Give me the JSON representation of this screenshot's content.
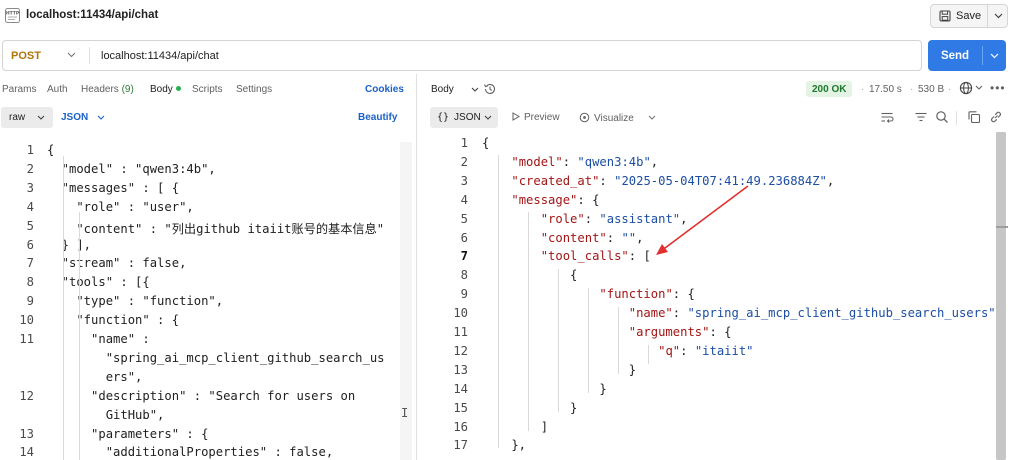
{
  "header": {
    "tab_title": "localhost:11434/api/chat",
    "save_label": "Save"
  },
  "request": {
    "method": "POST",
    "url": "localhost:11434/api/chat",
    "send_label": "Send"
  },
  "left_tabs": {
    "params": "Params",
    "auth": "Auth",
    "headers": "Headers",
    "headers_count": "(9)",
    "body": "Body",
    "scripts": "Scripts",
    "settings": "Settings",
    "cookies": "Cookies"
  },
  "body_options": {
    "mode": "raw",
    "format": "JSON",
    "beautify": "Beautify"
  },
  "response_header": {
    "view": "Body",
    "status": "200 OK",
    "time": "17.50 s",
    "size": "530 B",
    "separator": "·"
  },
  "response_options": {
    "format": "JSON",
    "preview": "Preview",
    "visualize": "Visualize"
  },
  "request_body_lines": [
    {
      "n": "1",
      "t": "{"
    },
    {
      "n": "2",
      "t": "  \"model\" : \"qwen3:4b\","
    },
    {
      "n": "3",
      "t": "  \"messages\" : [ {"
    },
    {
      "n": "4",
      "t": "    \"role\" : \"user\","
    },
    {
      "n": "5",
      "t": "    \"content\" : \"列出github itaiit账号的基本信息\""
    },
    {
      "n": "6",
      "t": "  } ],"
    },
    {
      "n": "7",
      "t": "  \"stream\" : false,"
    },
    {
      "n": "8",
      "t": "  \"tools\" : [{"
    },
    {
      "n": "9",
      "t": "    \"type\" : \"function\","
    },
    {
      "n": "10",
      "t": "    \"function\" : {"
    },
    {
      "n": "11",
      "t": "      \"name\" :"
    },
    {
      "n": "",
      "t": "        \"spring_ai_mcp_client_github_search_us"
    },
    {
      "n": "",
      "t": "        ers\","
    },
    {
      "n": "12",
      "t": "      \"description\" : \"Search for users on"
    },
    {
      "n": "",
      "t": "        GitHub\","
    },
    {
      "n": "13",
      "t": "      \"parameters\" : {"
    },
    {
      "n": "14",
      "t": "        \"additionalProperties\" : false,"
    }
  ],
  "response_body_lines": [
    {
      "n": "1",
      "t": "{"
    },
    {
      "n": "2",
      "t": "    \"model\": \"qwen3:4b\","
    },
    {
      "n": "3",
      "t": "    \"created_at\": \"2025-05-04T07:41:49.236884Z\","
    },
    {
      "n": "4",
      "t": "    \"message\": {"
    },
    {
      "n": "5",
      "t": "        \"role\": \"assistant\","
    },
    {
      "n": "6",
      "t": "        \"content\": \"\","
    },
    {
      "n": "7",
      "t": "        \"tool_calls\": ["
    },
    {
      "n": "8",
      "t": "            {"
    },
    {
      "n": "9",
      "t": "                \"function\": {"
    },
    {
      "n": "10",
      "t": "                    \"name\": \"spring_ai_mcp_client_github_search_users\","
    },
    {
      "n": "11",
      "t": "                    \"arguments\": {"
    },
    {
      "n": "12",
      "t": "                        \"q\": \"itaiit\""
    },
    {
      "n": "13",
      "t": "                    }"
    },
    {
      "n": "14",
      "t": "                }"
    },
    {
      "n": "15",
      "t": "            }"
    },
    {
      "n": "16",
      "t": "        ]"
    },
    {
      "n": "17",
      "t": "    },"
    }
  ],
  "colors": {
    "accent": "#2f7ae5",
    "method": "#b0740a",
    "status_ok_bg": "#e3f3e4",
    "status_ok_fg": "#1f7a2d",
    "json_key": "#a31515",
    "json_string": "#1c4ea3",
    "annotation_arrow": "#e03030"
  }
}
